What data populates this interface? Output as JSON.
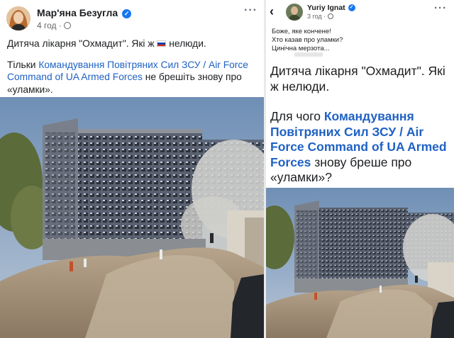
{
  "left_post": {
    "author": "Мар'яна Безугла",
    "time": "4 год",
    "globe_icon": "globe-icon",
    "more_icon": "more-options-icon",
    "line1_before": "Дитяча лікарня \"Охмадит\". Які ж",
    "line1_after": "нелюди.",
    "flag_icon": "russia-flag-icon",
    "line2_before": "Тільки",
    "line2_link": "Командування Повітряних Сил ЗСУ / Air Force Command of UA Armed Forces",
    "line2_after": "не брешіть знову про «уламки».",
    "photo": "destroyed-hospital-photo"
  },
  "right_post": {
    "back_icon": "back-arrow-icon",
    "author": "Yuriy Ignat",
    "time": "3 год",
    "more_icon": "more-options-icon",
    "comment_lines": [
      "Боже, яке кончене!",
      "Хто казав про уламки?",
      "Цинічна мерзота..."
    ],
    "quoted_text_1": "Дитяча лікарня \"Охмадит\". Які ж нелюди.",
    "quoted_before": "Для чого",
    "quoted_link": "Командування Повітряних Сил ЗСУ / Air Force Command of UA Armed Forces",
    "quoted_after": "знову бреше про «уламки»?",
    "photo": "destroyed-hospital-photo"
  },
  "colors": {
    "link": "#2062c4",
    "verified": "#1877f2",
    "text": "#1c1e21",
    "meta": "#65676b"
  }
}
